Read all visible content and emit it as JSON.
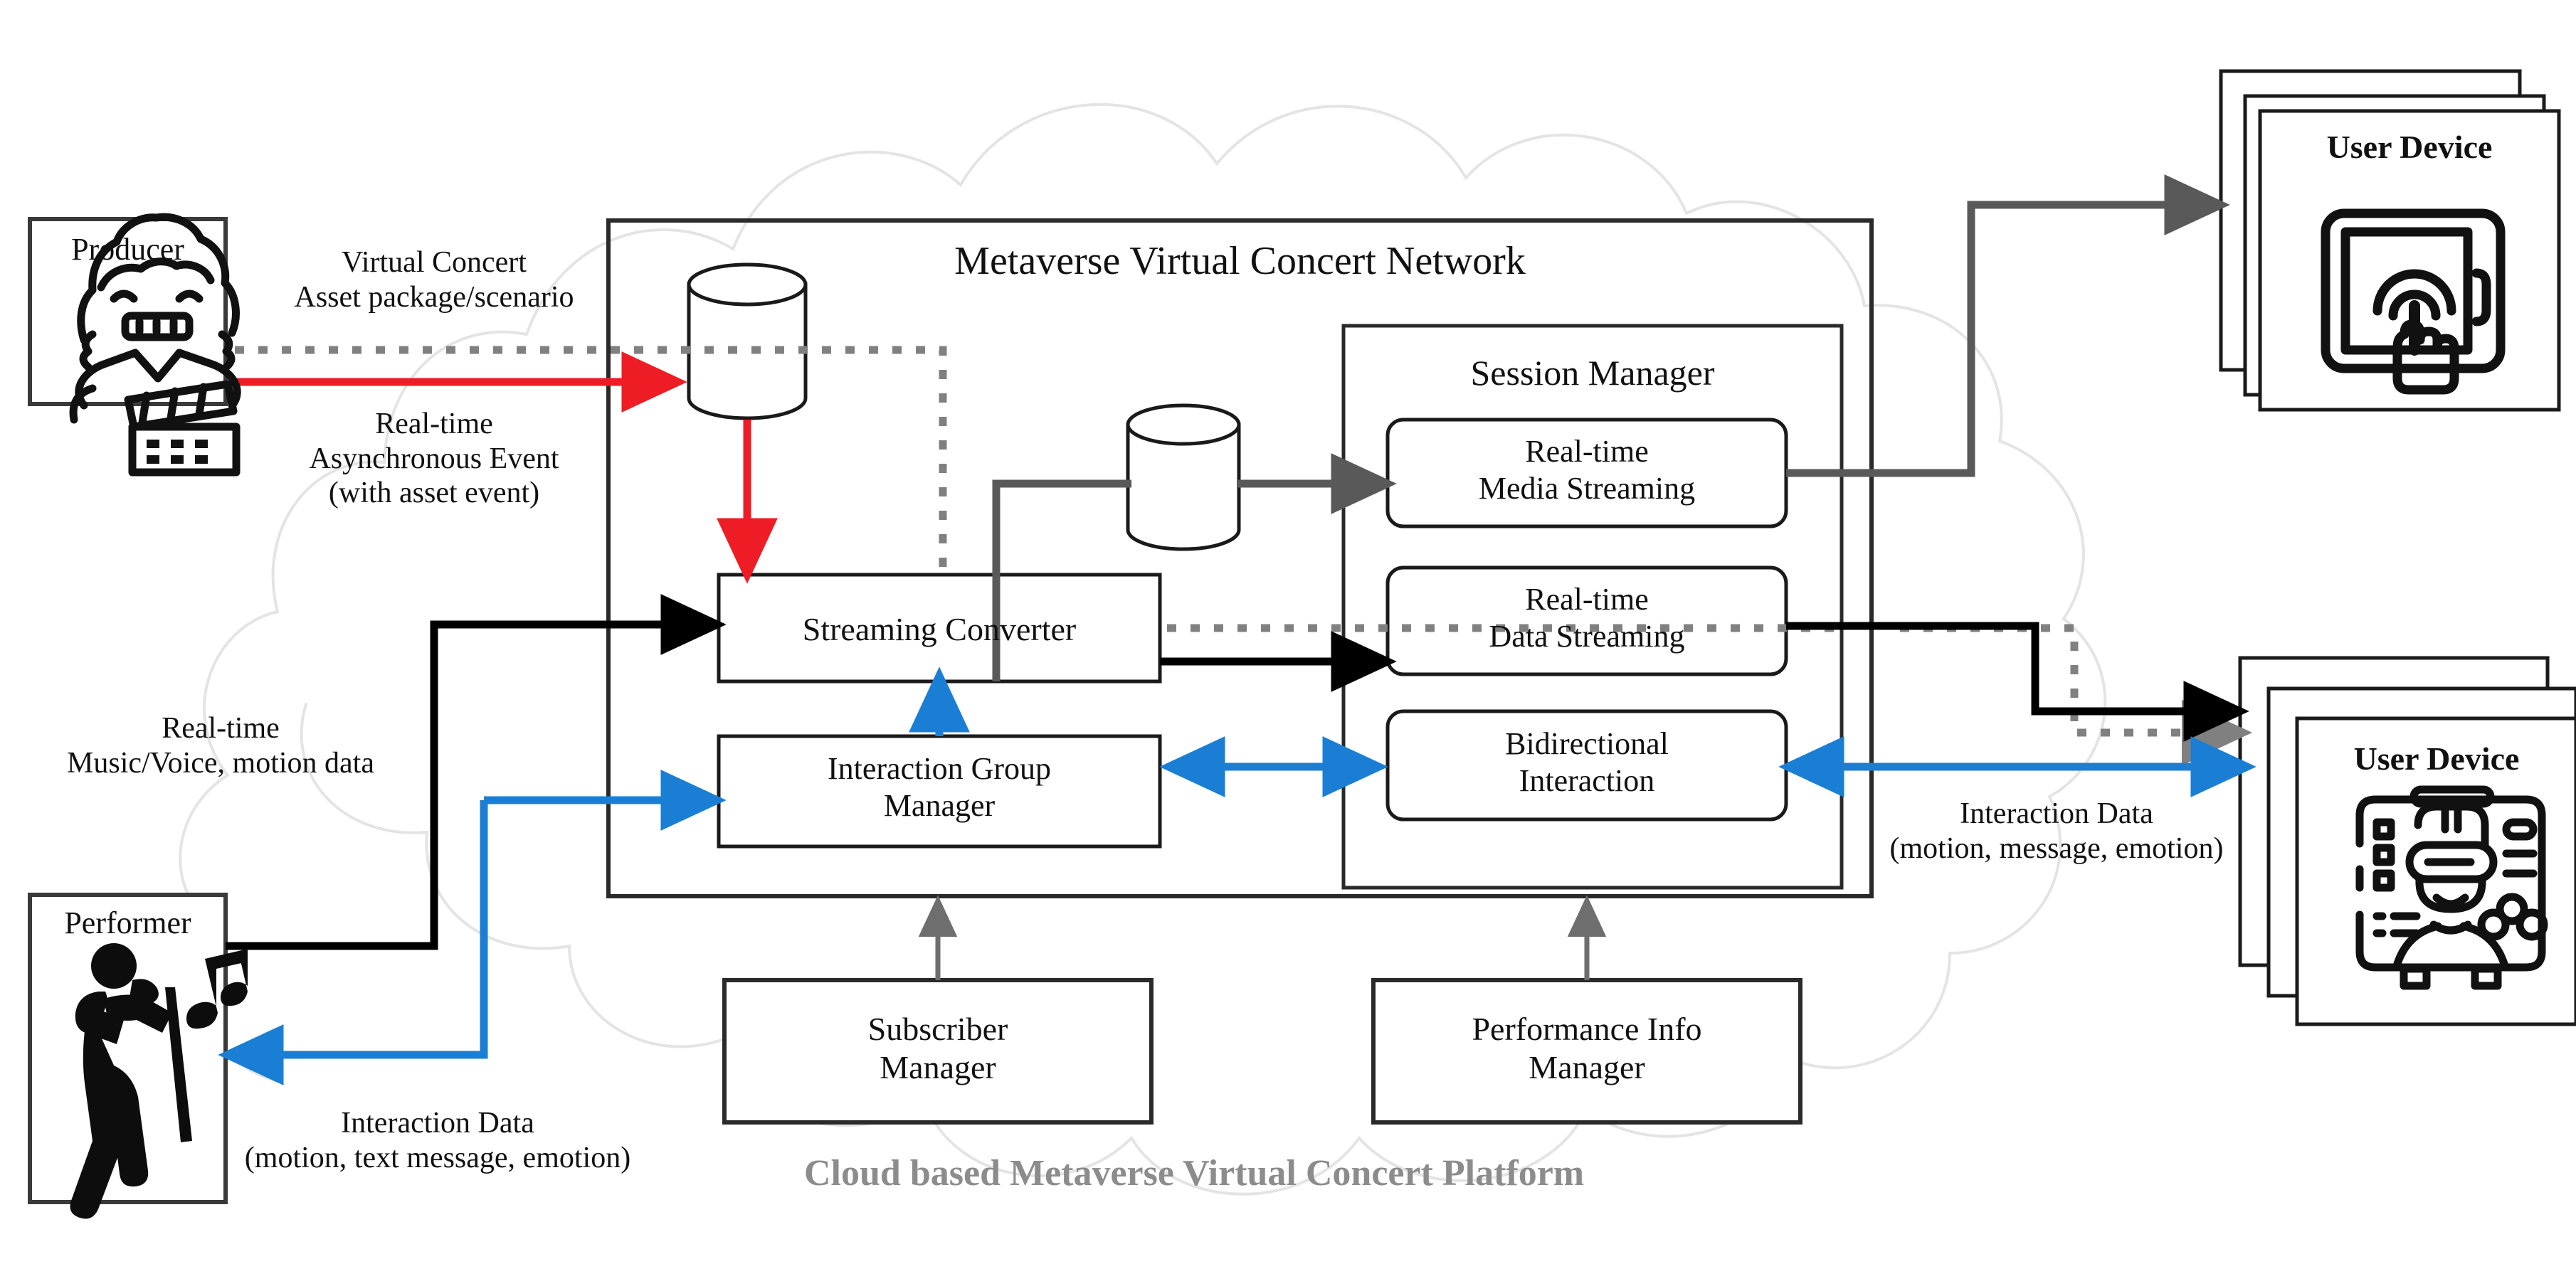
{
  "diagram": {
    "cloud_caption": "Cloud based Metaverse Virtual Concert Platform",
    "network_title": "Metaverse Virtual Concert Network",
    "session_manager_title": "Session Manager"
  },
  "entities": {
    "producer": {
      "label": "Producer",
      "icon": "producer-clapperboard-icon"
    },
    "performer": {
      "label": "Performer",
      "icon": "performer-singer-icon"
    },
    "user_device_top": {
      "label": "User Device",
      "icon": "tablet-touch-icon"
    },
    "user_device_bottom": {
      "label": "User Device",
      "icon": "vr-headset-avatar-icon"
    }
  },
  "blocks": {
    "streaming_converter": "Streaming Converter",
    "interaction_group_manager": "Interaction Group\nManager",
    "subscriber_manager": "Subscriber\nManager",
    "performance_info_manager": "Performance Info\nManager",
    "real_time_media_streaming": "Real-time\nMedia Streaming",
    "real_time_data_streaming": "Real-time\nData Streaming",
    "bidirectional_interaction": "Bidirectional\nInteraction"
  },
  "stores": {
    "asset_store": "asset-database-cylinder",
    "media_store": "media-database-cylinder"
  },
  "edge_labels": {
    "virtual_concert_asset": "Virtual Concert\nAsset package/scenario",
    "realtime_async_event": "Real-time\nAsynchronous Event\n(with asset event)",
    "realtime_music_motion": "Real-time\nMusic/Voice, motion data",
    "interaction_data_performer": "Interaction Data\n(motion, text message, emotion)",
    "interaction_data_user": "Interaction Data\n(motion, message, emotion)"
  },
  "colors": {
    "red": "#ee1c24",
    "blue": "#1a7fd4",
    "black": "#000000",
    "gray": "#595959",
    "dashed_gray": "#808080",
    "cloud": "#e8e8e8",
    "cloud_text": "#8c8c8c"
  }
}
